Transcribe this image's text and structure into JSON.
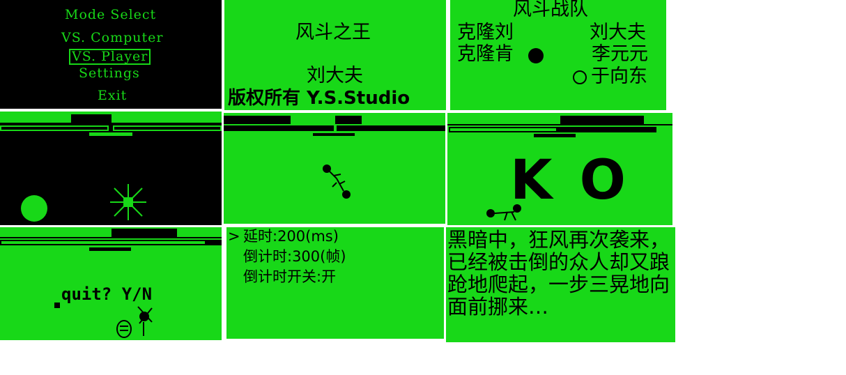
{
  "menu": {
    "title": "Mode Select",
    "items": [
      "VS. Computer",
      "VS. Player",
      "Settings",
      "Exit"
    ],
    "selected_index": 1
  },
  "title_screen": {
    "game_title": "风斗之王",
    "author": "刘大夫",
    "copyright": "版权所有 Y.S.Studio"
  },
  "team_select": {
    "header": "风斗战队",
    "left": [
      "克隆刘",
      "克隆肯"
    ],
    "right": [
      "刘大夫",
      "李元元",
      "于向东"
    ]
  },
  "ko_screen": {
    "text": "K O"
  },
  "quit_screen": {
    "prompt": "quit? Y/N"
  },
  "settings": {
    "cursor": ">",
    "items": [
      "延时:200(ms)",
      "倒计时:300(帧)",
      "倒计时开关:开"
    ]
  },
  "story": {
    "text": "黑暗中，狂风再次袭来，已经被击倒的众人却又踉跄地爬起，一步三晃地向面前挪来…"
  },
  "colors": {
    "screen_green": "#18d818",
    "screen_black": "#000000"
  }
}
